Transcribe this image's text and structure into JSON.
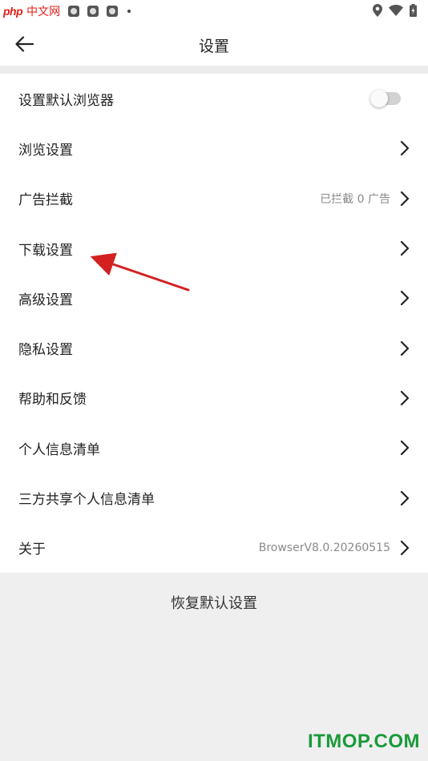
{
  "status_bar": {
    "logo_php": "php",
    "logo_cn": "中文网",
    "left_icons": [
      "app-icon",
      "app-icon",
      "app-icon",
      "app-icon"
    ],
    "right_icons": [
      "location-icon",
      "wifi-icon",
      "battery-icon"
    ]
  },
  "header": {
    "title": "设置",
    "back_icon": "back-arrow-icon"
  },
  "settings": {
    "items": [
      {
        "label": "设置默认浏览器",
        "control": "toggle",
        "toggle_on": false
      },
      {
        "label": "浏览设置",
        "control": "chevron"
      },
      {
        "label": "广告拦截",
        "value": "已拦截 0 广告",
        "control": "chevron"
      },
      {
        "label": "下载设置",
        "control": "chevron"
      },
      {
        "label": "高级设置",
        "control": "chevron"
      },
      {
        "label": "隐私设置",
        "control": "chevron"
      },
      {
        "label": "帮助和反馈",
        "control": "chevron"
      },
      {
        "label": "个人信息清单",
        "control": "chevron"
      },
      {
        "label": "三方共享个人信息清单",
        "control": "chevron"
      },
      {
        "label": "关于",
        "value": "BrowserV8.0.20260515",
        "control": "chevron"
      }
    ]
  },
  "footer": {
    "reset_label": "恢复默认设置"
  },
  "watermark": {
    "text": "ITMOP.COM",
    "color": "#1a9a3a"
  },
  "colors": {
    "annotation_arrow": "#d42020",
    "page_background": "#efefef"
  }
}
